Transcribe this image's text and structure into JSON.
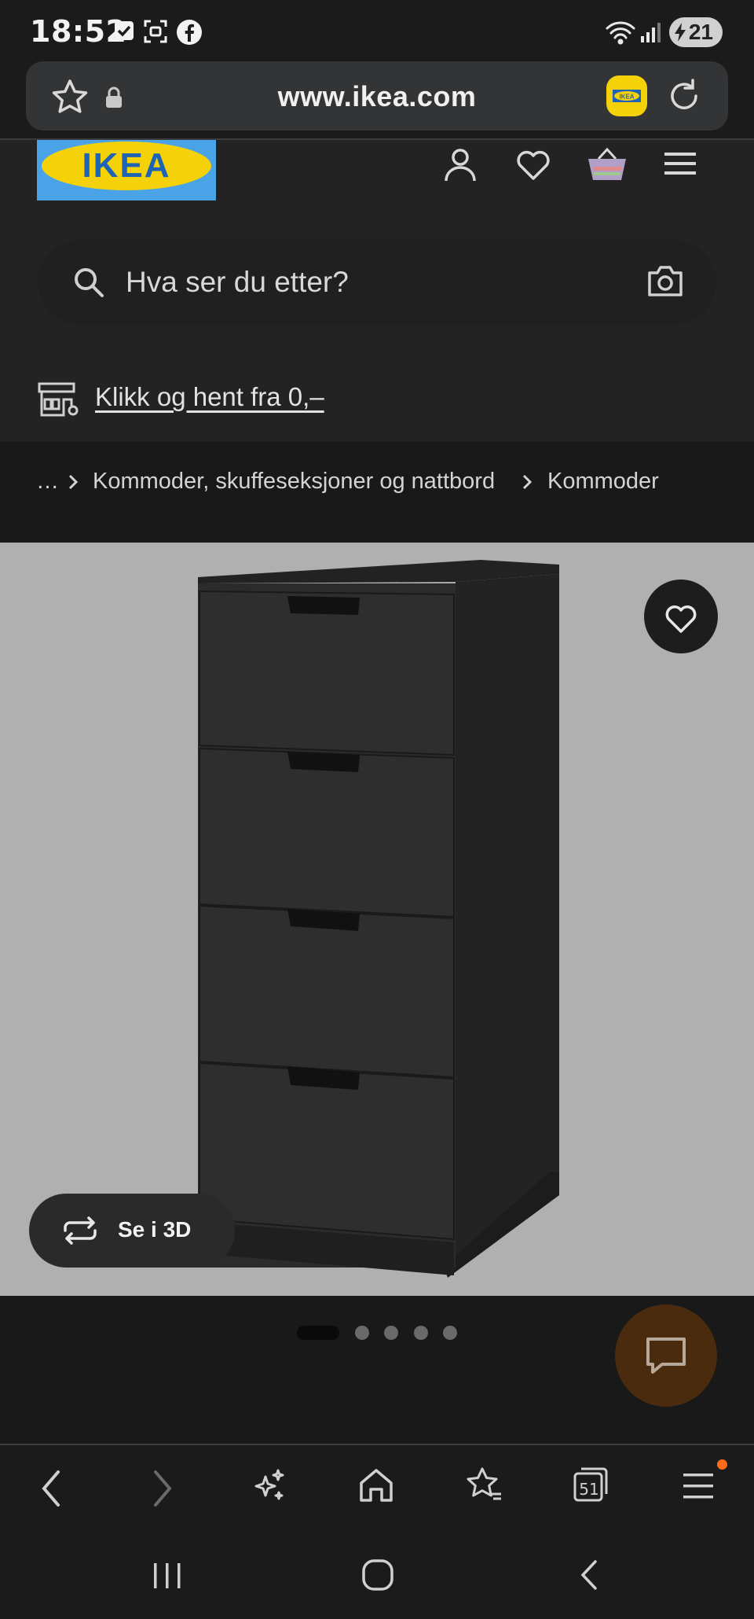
{
  "status_bar": {
    "time": "18:52",
    "battery_level": "21",
    "icons": [
      "check-notification-icon",
      "screenshot-icon",
      "facebook-icon",
      "wifi-icon",
      "signal-icon",
      "battery-charging-icon"
    ]
  },
  "browser": {
    "url": "www.ikea.com",
    "icons": [
      "bookmark-star-icon",
      "lock-icon",
      "ikea-extension-icon",
      "reload-icon"
    ]
  },
  "site_header": {
    "logo_text": "IKEA",
    "icons": [
      "account-icon",
      "wishlist-heart-icon",
      "shopping-bag-icon",
      "menu-icon"
    ],
    "search_placeholder": "Hva ser du etter?",
    "click_collect": "Klikk og hent fra 0,–"
  },
  "breadcrumb": {
    "ellipsis": "…",
    "items": [
      "Kommoder, skuffeseksjoner og nattbord",
      "Kommoder"
    ]
  },
  "product_media": {
    "view_3d_label": "Se i 3D",
    "carousel_total": 5,
    "carousel_active": 1
  },
  "bottom_nav": {
    "tab_count": "51",
    "items": [
      "back",
      "forward",
      "ai-assistant",
      "home",
      "bookmarks",
      "tabs",
      "menu"
    ]
  },
  "colors": {
    "ikea_blue": "#4aa3e6",
    "ikea_yellow": "#f5d10a",
    "notification": "#ff6a1a"
  }
}
